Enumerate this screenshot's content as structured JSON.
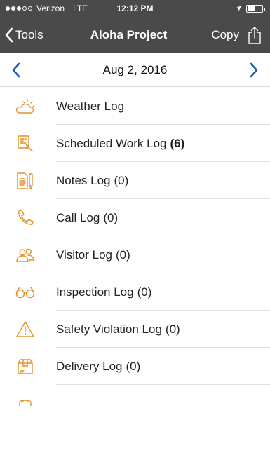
{
  "status_bar": {
    "carrier": "Verizon",
    "network": "LTE",
    "time": "12:12 PM"
  },
  "nav": {
    "back_label": "Tools",
    "title": "Aloha Project",
    "copy_label": "Copy"
  },
  "date_bar": {
    "date": "Aug 2, 2016"
  },
  "colors": {
    "header_bg": "#4a4a4a",
    "accent_blue": "#1a5fb4",
    "icon_orange": "#e8912a"
  },
  "logs": [
    {
      "label": "Weather Log",
      "count": "",
      "icon": "weather-icon"
    },
    {
      "label": "Scheduled Work Log",
      "count": "(6)",
      "icon": "scheduled-work-icon"
    },
    {
      "label": "Notes Log",
      "count": "(0)",
      "icon": "notes-icon"
    },
    {
      "label": "Call Log",
      "count": "(0)",
      "icon": "phone-icon"
    },
    {
      "label": "Visitor Log",
      "count": "(0)",
      "icon": "visitors-icon"
    },
    {
      "label": "Inspection Log",
      "count": "(0)",
      "icon": "glasses-icon"
    },
    {
      "label": "Safety Violation Log",
      "count": "(0)",
      "icon": "warning-icon"
    },
    {
      "label": "Delivery Log",
      "count": "(0)",
      "icon": "delivery-box-icon"
    }
  ]
}
